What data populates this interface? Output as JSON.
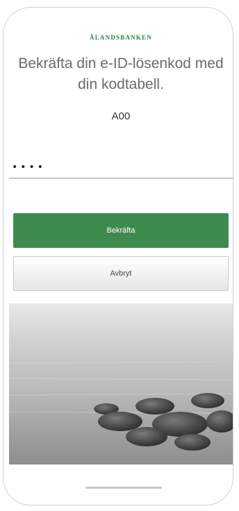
{
  "app": {
    "brand": "ÅLANDSBANKEN",
    "title": "Bekräfta din e-ID-lösenkod med din kodtabell.",
    "code_label": "A00",
    "password_value": "••••",
    "confirm_label": "Bekräfta",
    "cancel_label": "Avbryt"
  },
  "colors": {
    "brand_green": "#2e7d4a",
    "confirm_button": "#3f8a4f",
    "title_gray": "#6a6a6a"
  }
}
